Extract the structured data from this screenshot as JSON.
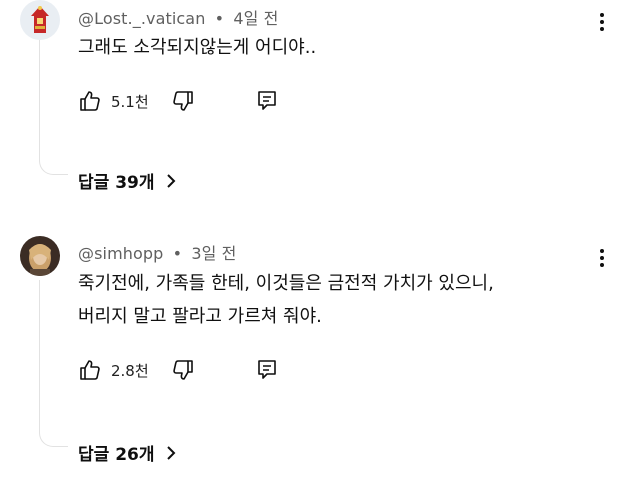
{
  "comments": [
    {
      "username": "@Lost._.vatican",
      "separator": "•",
      "time": "4일 전",
      "text": "그래도 소각되지않는게 어디야..",
      "likes": "5.1천",
      "replies_label": "답글 39개"
    },
    {
      "username": "@simhopp",
      "separator": "•",
      "time": "3일 전",
      "text": "죽기전에, 가족들 한테, 이것들은 금전적 가치가 있으니,\n버리지 말고 팔라고 가르쳐 줘야.",
      "likes": "2.8천",
      "replies_label": "답글 26개"
    }
  ],
  "colors": {
    "meta_text": "#606060",
    "body_text": "#111111",
    "thread_line": "#e2e2e2"
  },
  "icons": [
    "kebab-menu-icon",
    "thumbs-up-icon",
    "thumbs-down-icon",
    "reply-icon",
    "chevron-right-icon"
  ]
}
